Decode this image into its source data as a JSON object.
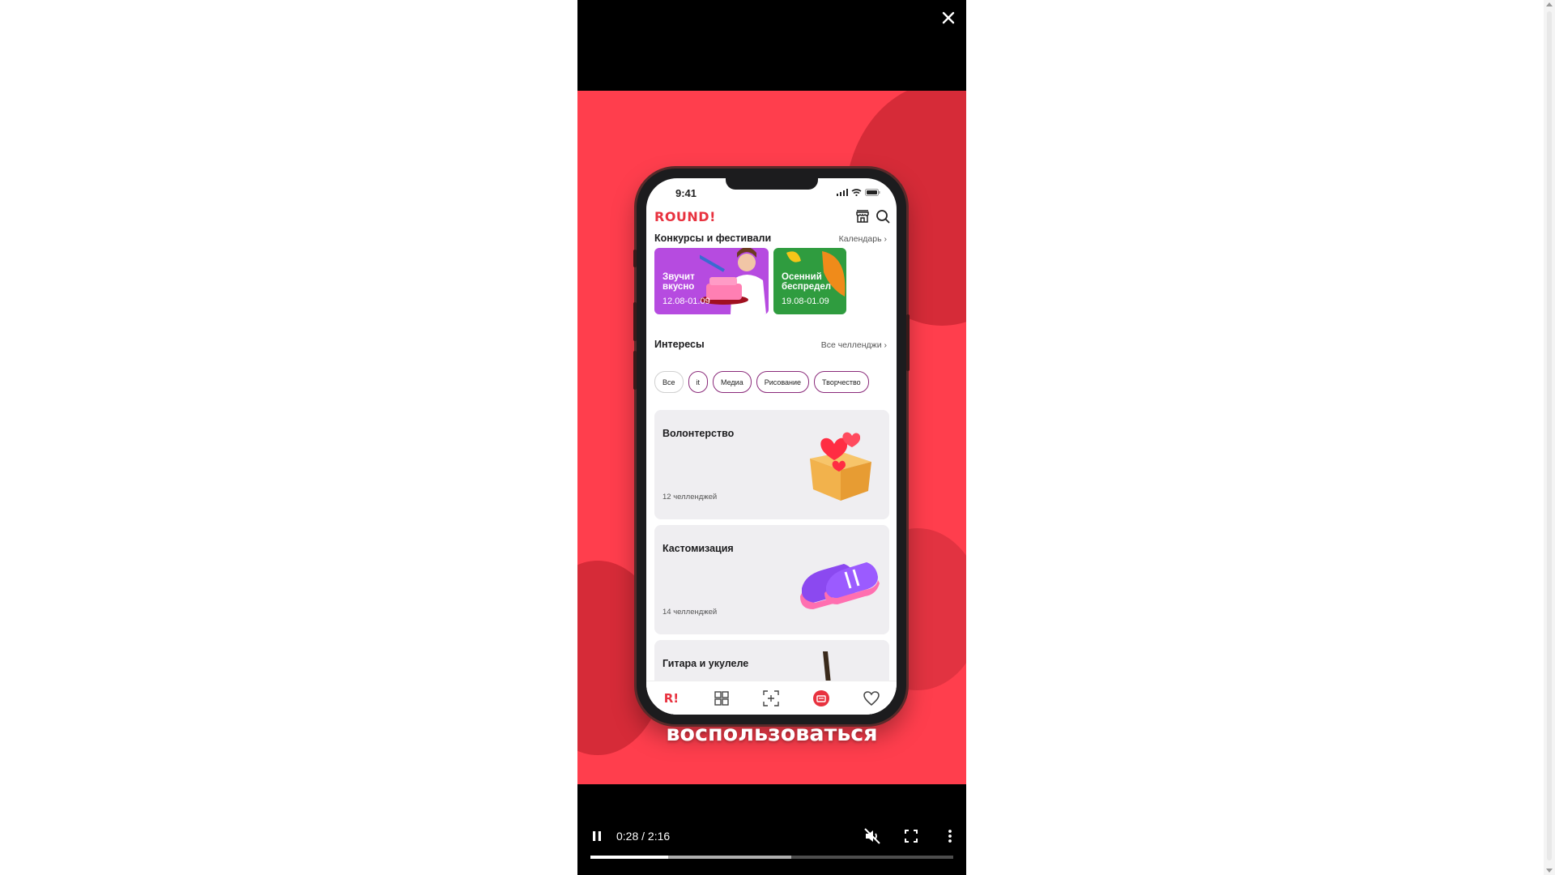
{
  "app": {
    "status_time": "9:41",
    "logo": "ROUND!",
    "contests": {
      "title": "Конкурсы и фестивали",
      "link": "Календарь",
      "items": [
        {
          "title": "Звучит вкусно",
          "dates": "12.08-01.09",
          "color": "#b64be0"
        },
        {
          "title": "Осенний беспредел",
          "dates": "19.08-01.09",
          "color": "#2f9c3f"
        }
      ]
    },
    "interests": {
      "title": "Интересы",
      "link": "Все челленджи",
      "chips": [
        "Все",
        "it",
        "Медиа",
        "Рисование",
        "Творчество"
      ]
    },
    "cards": [
      {
        "title": "Волонтерство",
        "count": "12 челленджей"
      },
      {
        "title": "Кастомизация",
        "count": "14 челленджей"
      },
      {
        "title": "Гитара и укулеле",
        "count": ""
      }
    ],
    "tabs": [
      "home-tab",
      "catalog-tab",
      "scan-tab",
      "challenges-tab",
      "favorites-tab"
    ]
  },
  "subtitle": "воспользоваться",
  "player": {
    "time": "0:28 / 2:16",
    "played_fraction": 0.214,
    "buffered_fraction": 0.553
  },
  "colors": {
    "video_bg": "#ff3e4d",
    "brand": "#e8323f",
    "chip_border": "#8a2a7a"
  }
}
